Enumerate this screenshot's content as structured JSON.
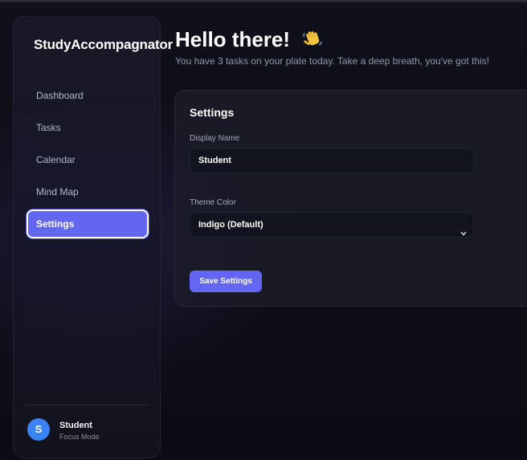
{
  "sidebar": {
    "brand": "StudyAccompagnator",
    "items": [
      {
        "label": "Dashboard"
      },
      {
        "label": "Tasks"
      },
      {
        "label": "Calendar"
      },
      {
        "label": "Mind Map"
      },
      {
        "label": "Settings",
        "active": true
      }
    ],
    "user": {
      "initial": "S",
      "name": "Student",
      "mode": "Focus Mode"
    }
  },
  "header": {
    "greeting": "Hello there!",
    "greeting_icon": "waving-hand-icon",
    "subtitle": "You have 3 tasks on your plate today. Take a deep breath, you've got this!"
  },
  "settings": {
    "title": "Settings",
    "display_name_label": "Display Name",
    "display_name_value": "Student",
    "theme_label": "Theme Color",
    "theme_value": "Indigo (Default)",
    "save_label": "Save Settings"
  },
  "colors": {
    "accent": "#6366f1",
    "avatar": "#3b82f6",
    "background": "#0d0f17"
  }
}
